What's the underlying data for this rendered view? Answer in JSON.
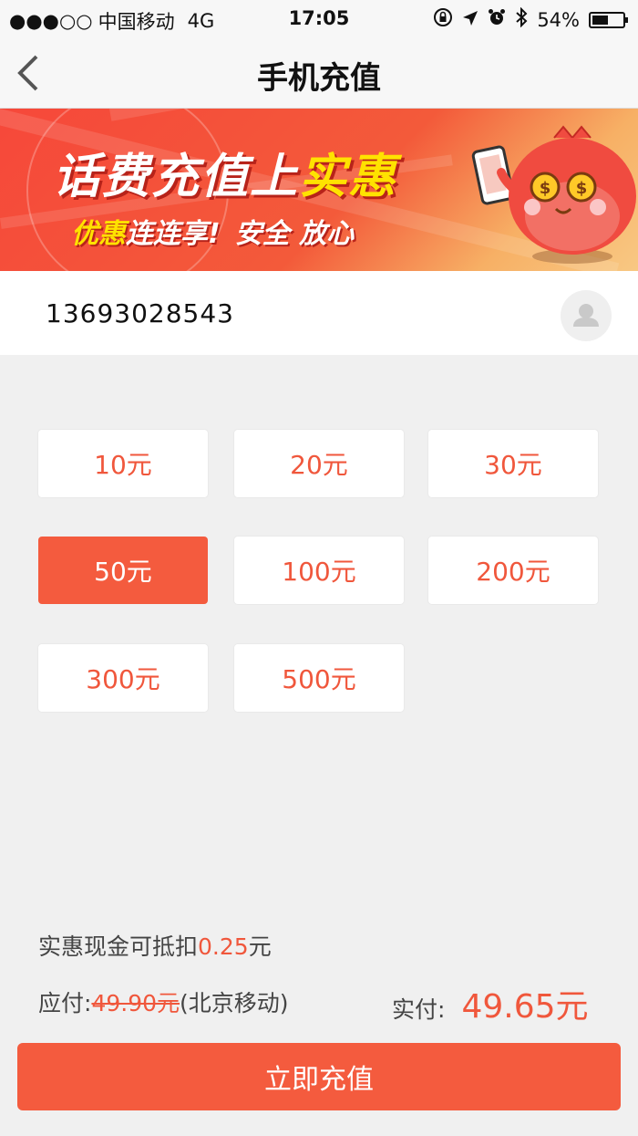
{
  "status_bar": {
    "signal": "●●●○○",
    "carrier": "中国移动",
    "network": "4G",
    "time": "17:05",
    "battery_text": "54%",
    "battery_level": 0.54,
    "icons": [
      "lock-rotation-icon",
      "location-arrow-icon",
      "alarm-icon",
      "bluetooth-icon",
      "battery-icon"
    ]
  },
  "nav": {
    "title": "手机充值",
    "back_icon": "chevron-left-icon"
  },
  "banner": {
    "headline_main": "话费充值上",
    "headline_highlight": "实惠",
    "subline_highlight": "优惠",
    "subline_main": "连连享!",
    "subline_rest": "安全 放心",
    "colors": {
      "primary": "#f6483a",
      "highlight": "#ffe200"
    }
  },
  "phone": {
    "value": "13693028543",
    "contact_icon": "contact-person-icon"
  },
  "amounts": [
    {
      "label": "10元",
      "selected": false
    },
    {
      "label": "20元",
      "selected": false
    },
    {
      "label": "30元",
      "selected": false
    },
    {
      "label": "50元",
      "selected": true
    },
    {
      "label": "100元",
      "selected": false
    },
    {
      "label": "200元",
      "selected": false
    },
    {
      "label": "300元",
      "selected": false
    },
    {
      "label": "500元",
      "selected": false
    }
  ],
  "summary": {
    "discount_prefix": "实惠现金可抵扣",
    "discount_value": "0.25",
    "discount_suffix": "元",
    "payable_label": "应付:",
    "payable_original": "49.90元",
    "payable_note": "(北京移动)",
    "actual_label": "实付:",
    "actual_value": "49.65元"
  },
  "submit_label": "立即充值",
  "colors": {
    "accent": "#f45b3e",
    "amount_text": "#f0573c",
    "background": "#f0f0f0"
  }
}
